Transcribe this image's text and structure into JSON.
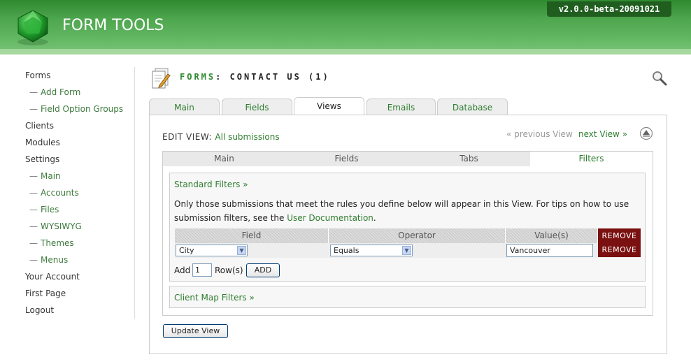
{
  "header": {
    "app_title": "FORM TOOLS",
    "version": "v2.0.0-beta-20091021"
  },
  "sidebar": {
    "items": [
      {
        "label": "Forms",
        "sub": false
      },
      {
        "label": "Add Form",
        "sub": true
      },
      {
        "label": "Field Option Groups",
        "sub": true
      },
      {
        "label": "Clients",
        "sub": false
      },
      {
        "label": "Modules",
        "sub": false
      },
      {
        "label": "Settings",
        "sub": false
      },
      {
        "label": "Main",
        "sub": true
      },
      {
        "label": "Accounts",
        "sub": true
      },
      {
        "label": "Files",
        "sub": true
      },
      {
        "label": "WYSIWYG",
        "sub": true
      },
      {
        "label": "Themes",
        "sub": true
      },
      {
        "label": "Menus",
        "sub": true
      },
      {
        "label": "Your Account",
        "sub": false
      },
      {
        "label": "First Page",
        "sub": false
      },
      {
        "label": "Logout",
        "sub": false
      }
    ],
    "sub_prefix": "—"
  },
  "page": {
    "title_prefix": "FORMS",
    "title_rest": ": CONTACT US (1)"
  },
  "main_tabs": [
    {
      "label": "Main",
      "active": false
    },
    {
      "label": "Fields",
      "active": false
    },
    {
      "label": "Views",
      "active": true
    },
    {
      "label": "Emails",
      "active": false
    },
    {
      "label": "Database",
      "active": false
    }
  ],
  "edit_view": {
    "label": "EDIT VIEW:",
    "view_name": "All submissions",
    "prev_link": "« previous View",
    "next_link": "next View »"
  },
  "sub_tabs": [
    {
      "label": "Main",
      "active": false
    },
    {
      "label": "Fields",
      "active": false
    },
    {
      "label": "Tabs",
      "active": false
    },
    {
      "label": "Filters",
      "active": true
    }
  ],
  "standard_filters": {
    "title": "Standard Filters »",
    "description_line1": "Only those submissions that meet the rules you define below will appear in this View. For tips on how to use",
    "description_line2_pre": "submission filters, see the ",
    "description_link": "User Documentation",
    "description_line2_post": ".",
    "table": {
      "headers": [
        "Field",
        "Operator",
        "Value(s)"
      ],
      "remove_header": "REMOVE",
      "rows": [
        {
          "field": "City",
          "operator": "Equals",
          "value": "Vancouver",
          "remove": "REMOVE"
        }
      ]
    },
    "add": {
      "label": "Add",
      "count": "1",
      "rows_label": "Row(s)",
      "button": "ADD"
    }
  },
  "client_map_filters": {
    "title": "Client Map Filters »"
  },
  "update_button": "Update View",
  "colors": {
    "header_green": "#4ea64e",
    "link_green": "#2e7d2e",
    "remove_red": "#7a1010"
  }
}
